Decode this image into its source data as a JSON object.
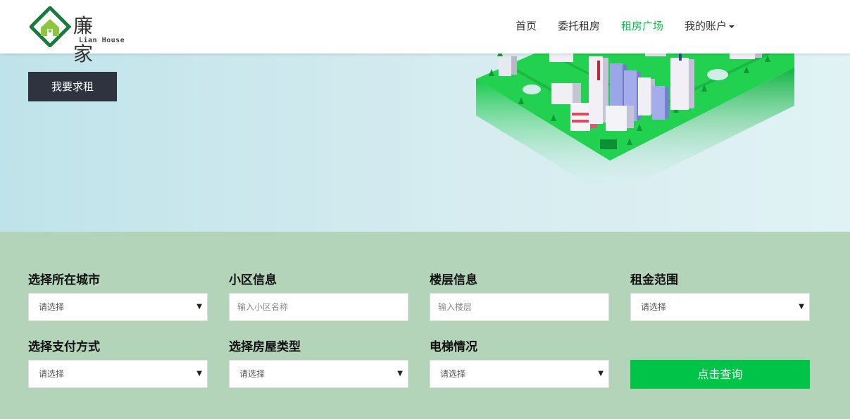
{
  "brand": {
    "name_cn": "廉 家",
    "name_en": "Lian House",
    "colors": {
      "green": "#00c447",
      "dark_green": "#1a7a3e",
      "lime": "#8cc63f"
    }
  },
  "nav": {
    "items": [
      {
        "label": "首页",
        "active": false
      },
      {
        "label": "委托租房",
        "active": false
      },
      {
        "label": "租房广场",
        "active": true
      },
      {
        "label": "我的账户",
        "active": false,
        "dropdown": true
      }
    ]
  },
  "hero": {
    "cta_label": "我要求租",
    "illustration": "isometric-green-city"
  },
  "search": {
    "fields": [
      {
        "label": "选择所在城市",
        "type": "select",
        "value": "请选择"
      },
      {
        "label": "小区信息",
        "type": "input",
        "placeholder": "输入小区名称"
      },
      {
        "label": "楼层信息",
        "type": "input",
        "placeholder": "输入楼层"
      },
      {
        "label": "租金范围",
        "type": "select",
        "value": "请选择"
      },
      {
        "label": "选择支付方式",
        "type": "select",
        "value": "请选择"
      },
      {
        "label": "选择房屋类型",
        "type": "select",
        "value": "请选择"
      },
      {
        "label": "电梯情况",
        "type": "select",
        "value": "请选择"
      }
    ],
    "submit_label": "点击查询",
    "select_arrow": "▼"
  }
}
